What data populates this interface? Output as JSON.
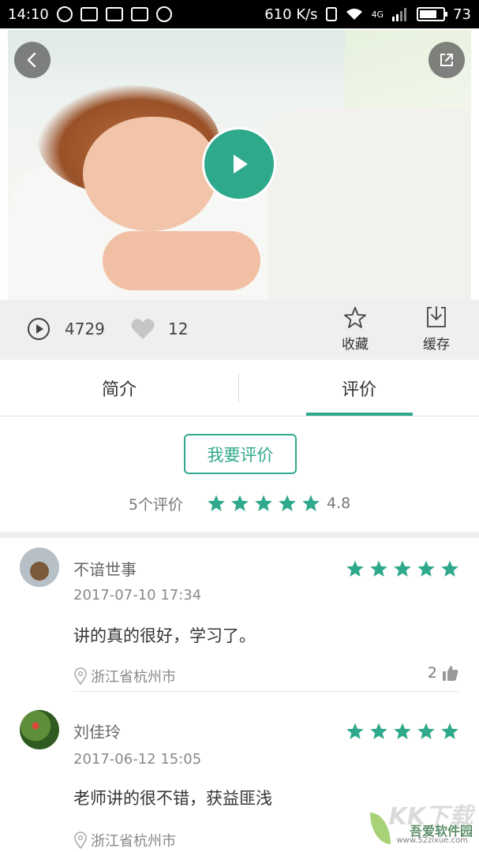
{
  "status_bar": {
    "time": "14:10",
    "net_speed": "610 K/s",
    "network": "4G",
    "battery": "73",
    "battery_level": 0.73
  },
  "player": {
    "back_icon": "chevron-left-icon",
    "share_icon": "external-share-icon",
    "play_icon": "play-icon"
  },
  "stats": {
    "plays": "4729",
    "likes": "12",
    "collect_label": "收藏",
    "download_label": "缓存"
  },
  "tabs": [
    {
      "label": "简介",
      "active": false
    },
    {
      "label": "评价",
      "active": true
    }
  ],
  "review_summary": {
    "button_label": "我要评价",
    "count_text": "5个评价",
    "rating": "4.8",
    "stars": 5
  },
  "reviews": [
    {
      "name": "不谙世事",
      "stars": 5,
      "time": "2017-07-10 17:34",
      "text": "讲的真的很好，学习了。",
      "location": "浙江省杭州市",
      "likes": "2"
    },
    {
      "name": "刘佳玲",
      "stars": 5,
      "time": "2017-06-12 15:05",
      "text": "老师讲的很不错，获益匪浅",
      "location": "浙江省杭州市",
      "likes": ""
    }
  ],
  "watermark": {
    "top": "KK下载",
    "main": "吾爱软件园",
    "url": "www.52zixue.com"
  },
  "colors": {
    "accent": "#2fa98c",
    "star": "#2fa98c"
  }
}
